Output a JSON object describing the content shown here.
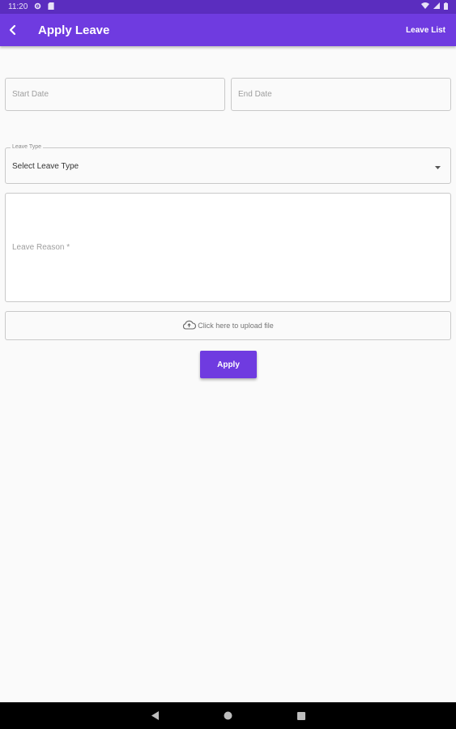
{
  "status_bar": {
    "time": "11:20",
    "icons": [
      "gear-icon",
      "sd-card-icon",
      "wifi-icon",
      "signal-icon",
      "battery-icon"
    ]
  },
  "app_bar": {
    "back_icon": "back-arrow-icon",
    "title": "Apply Leave",
    "action_label": "Leave List",
    "color": "#6f3be0"
  },
  "form": {
    "start_date": {
      "placeholder": "Start Date"
    },
    "end_date": {
      "placeholder": "End Date"
    },
    "leave_type": {
      "label": "Leave Type",
      "selected": "Select Leave Type",
      "icon": "dropdown-arrow-icon"
    },
    "leave_reason": {
      "placeholder": "Leave Reason *"
    },
    "upload": {
      "icon": "cloud-upload-icon",
      "label": "Click here to upload file"
    },
    "apply_label": "Apply"
  },
  "nav_bar": {
    "items": [
      "back-triangle-icon",
      "home-circle-icon",
      "recents-square-icon"
    ]
  }
}
